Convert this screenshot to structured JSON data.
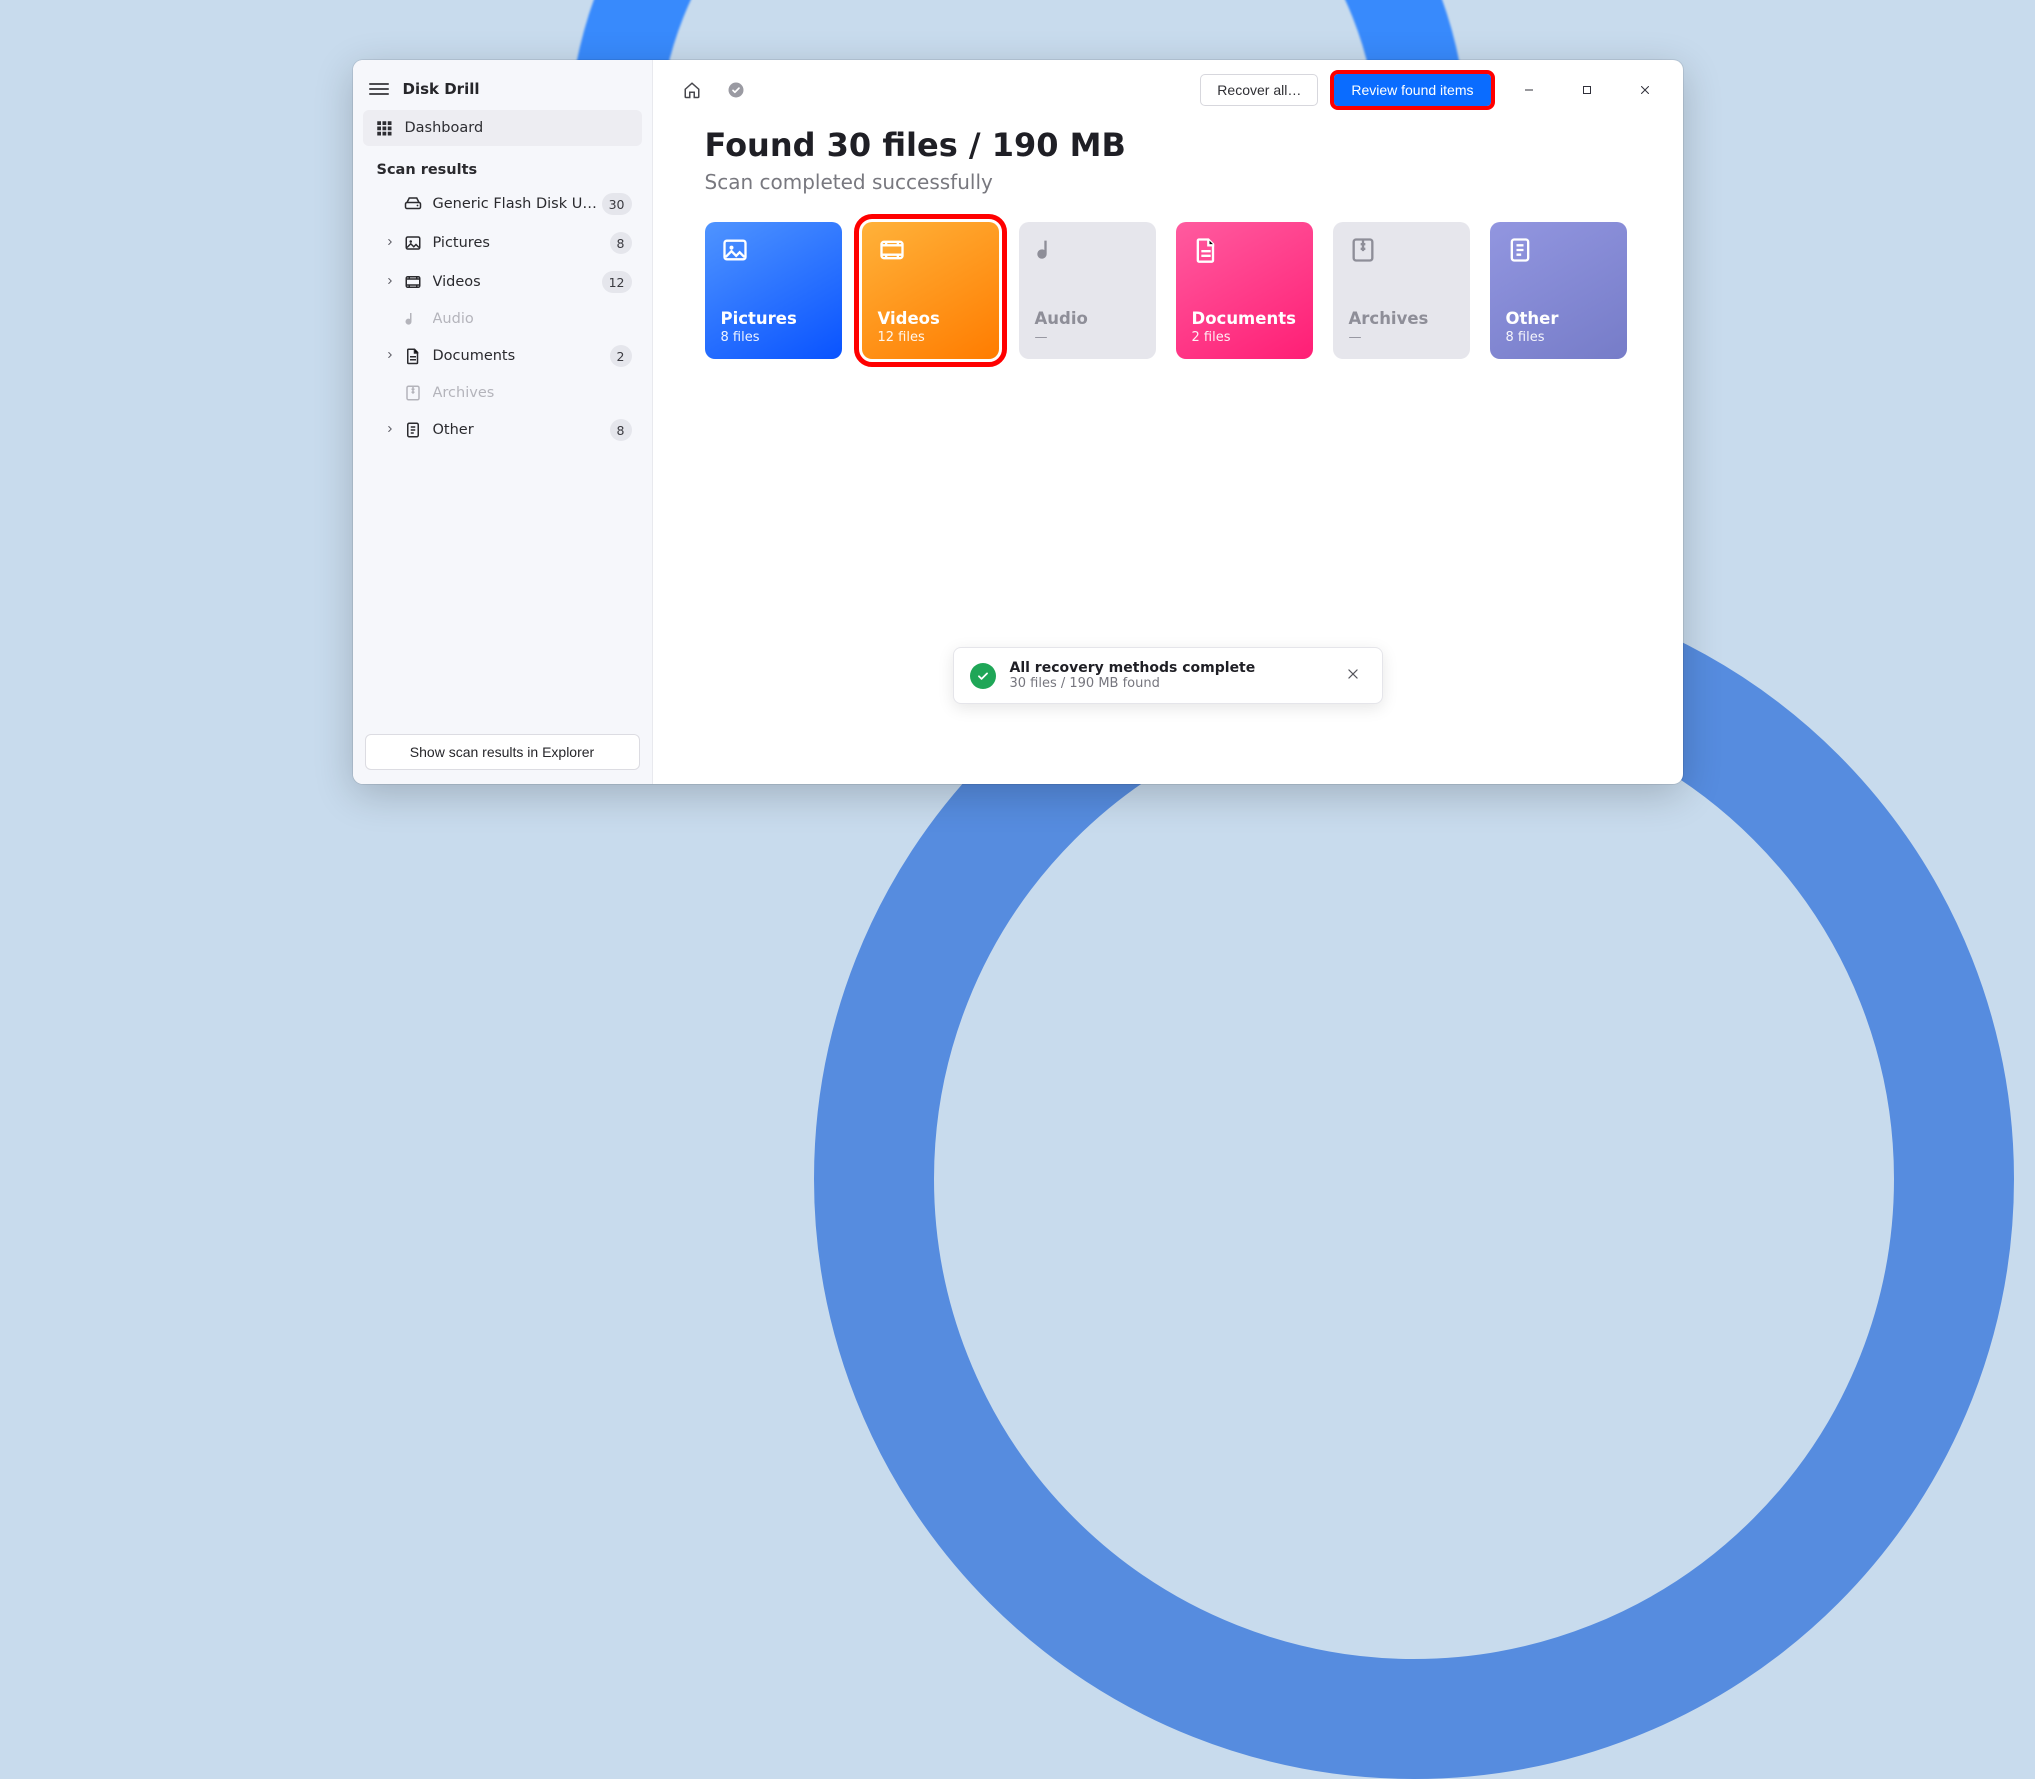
{
  "app": {
    "title": "Disk Drill"
  },
  "sidebar": {
    "dashboard": "Dashboard",
    "sectionHeader": "Scan results",
    "explorerButton": "Show scan results in Explorer",
    "items": [
      {
        "label": "Generic Flash Disk USB D…",
        "count": "30",
        "hasCount": true,
        "icon": "drive",
        "expandable": false,
        "disabled": false
      },
      {
        "label": "Pictures",
        "count": "8",
        "hasCount": true,
        "icon": "picture",
        "expandable": true,
        "disabled": false
      },
      {
        "label": "Videos",
        "count": "12",
        "hasCount": true,
        "icon": "video",
        "expandable": true,
        "disabled": false
      },
      {
        "label": "Audio",
        "count": "",
        "hasCount": false,
        "icon": "audio",
        "expandable": false,
        "disabled": true
      },
      {
        "label": "Documents",
        "count": "2",
        "hasCount": true,
        "icon": "doc",
        "expandable": true,
        "disabled": false
      },
      {
        "label": "Archives",
        "count": "",
        "hasCount": false,
        "icon": "archive",
        "expandable": false,
        "disabled": true
      },
      {
        "label": "Other",
        "count": "8",
        "hasCount": true,
        "icon": "other",
        "expandable": true,
        "disabled": false
      }
    ]
  },
  "toolbar": {
    "recoverAll": "Recover all…",
    "reviewFound": "Review found items"
  },
  "header": {
    "title": "Found 30 files / 190 MB",
    "subtitle": "Scan completed successfully"
  },
  "cards": {
    "pictures": {
      "title": "Pictures",
      "sub": "8 files"
    },
    "videos": {
      "title": "Videos",
      "sub": "12 files"
    },
    "audio": {
      "title": "Audio",
      "sub": "—"
    },
    "documents": {
      "title": "Documents",
      "sub": "2 files"
    },
    "archives": {
      "title": "Archives",
      "sub": "—"
    },
    "other": {
      "title": "Other",
      "sub": "8 files"
    }
  },
  "toast": {
    "title": "All recovery methods complete",
    "sub": "30 files / 190 MB found"
  }
}
